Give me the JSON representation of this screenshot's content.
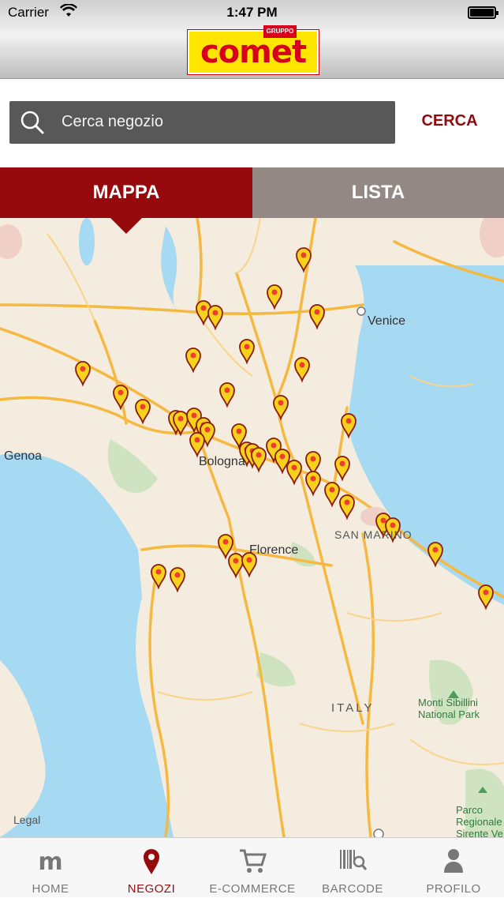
{
  "status": {
    "carrier": "Carrier",
    "time": "1:47 PM"
  },
  "brand": {
    "logo_text": "comet",
    "logo_tag": "GRUPPO"
  },
  "search": {
    "placeholder": "Cerca negozio",
    "button_label": "CERCA"
  },
  "tabs": [
    {
      "label": "MAPPA",
      "active": true
    },
    {
      "label": "LISTA",
      "active": false
    }
  ],
  "map": {
    "labels": {
      "venice": "Venice",
      "genoa": "Genoa",
      "bologna": "Bologna",
      "florence": "Florence",
      "san_marino": "SAN MARINO",
      "italy": "ITALY",
      "sibillini": "Monti Sibillini\nNational Park",
      "parco": "Parco\nRegionale\nSirente Ve",
      "legal": "Legal"
    }
  },
  "tabbar": [
    {
      "label": "HOME",
      "icon": "m-logo-icon",
      "active": false
    },
    {
      "label": "NEGOZI",
      "icon": "location-pin-icon",
      "active": true
    },
    {
      "label": "E-COMMERCE",
      "icon": "cart-icon",
      "active": false
    },
    {
      "label": "BARCODE",
      "icon": "barcode-icon",
      "active": false
    },
    {
      "label": "PROFILO",
      "icon": "person-icon",
      "active": false
    }
  ],
  "colors": {
    "accent": "#960a0e",
    "tab_inactive": "#948884",
    "sea": "#a6d9f2",
    "road": "#f5b942",
    "pin": "#f7d21c"
  }
}
